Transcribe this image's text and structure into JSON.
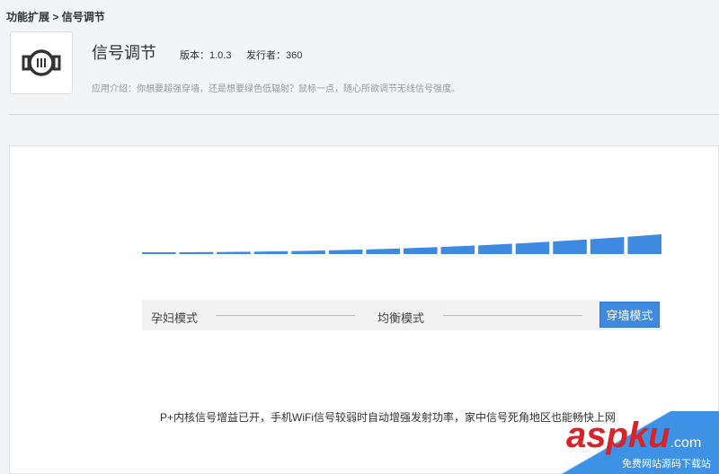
{
  "breadcrumb": {
    "parent": "功能扩展",
    "sep": ">",
    "current": "信号调节"
  },
  "app": {
    "icon": "signal-dial-icon",
    "title": "信号调节",
    "version": "版本：1.0.3",
    "publisher": "发行者：360",
    "description": "应用介绍：你想要超强穿墙，还是想要绿色低辐射？鼠标一点，随心所欲调节无线信号强度。"
  },
  "signal": {
    "segments": 14,
    "level_percent": 100,
    "color": "#3d8ae0"
  },
  "modes": {
    "pregnant": "孕妇模式",
    "balanced": "均衡模式",
    "wall": "穿墙模式",
    "selected": "穿墙模式"
  },
  "note": "P+内核信号增益已开，手机WiFi信号较弱时自动增强发射功率，家中信号死角地区也能畅快上网",
  "watermark": {
    "logo": "aspku",
    "domain": ".com",
    "sub": "免费网站源码下载站"
  }
}
